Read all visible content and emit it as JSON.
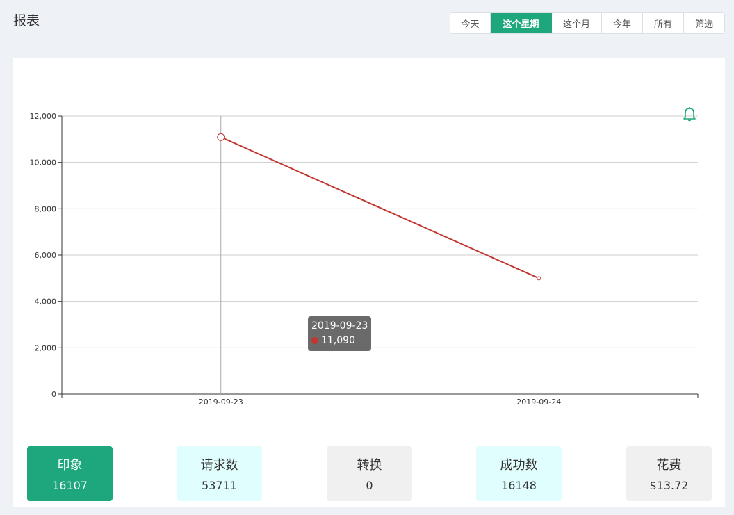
{
  "header": {
    "title": "报表"
  },
  "range_buttons": [
    {
      "label": "今天",
      "active": false
    },
    {
      "label": "这个星期",
      "active": true
    },
    {
      "label": "这个月",
      "active": false
    },
    {
      "label": "今年",
      "active": false
    },
    {
      "label": "所有",
      "active": false
    },
    {
      "label": "筛选",
      "active": false
    }
  ],
  "chart_data": {
    "type": "line",
    "x": [
      "2019-09-23",
      "2019-09-24"
    ],
    "series": [
      {
        "values": [
          11090,
          5000
        ],
        "color": "#c23531"
      }
    ],
    "ylim": [
      0,
      12000
    ],
    "yticks": [
      "0",
      "2,000",
      "4,000",
      "6,000",
      "8,000",
      "10,000",
      "12,000"
    ],
    "grid": true,
    "tooltip": {
      "date": "2019-09-23",
      "value": "11,090"
    }
  },
  "icons": {
    "alert": "bell-icon"
  },
  "stats": [
    {
      "label": "印象",
      "value": "16107",
      "style": "green"
    },
    {
      "label": "请求数",
      "value": "53711",
      "style": "cyan"
    },
    {
      "label": "转换",
      "value": "0",
      "style": "gray"
    },
    {
      "label": "成功数",
      "value": "16148",
      "style": "cyan"
    },
    {
      "label": "花费",
      "value": "$13.72",
      "style": "gray"
    }
  ],
  "colors": {
    "accent": "#1ea67c",
    "line": "#c23531"
  }
}
